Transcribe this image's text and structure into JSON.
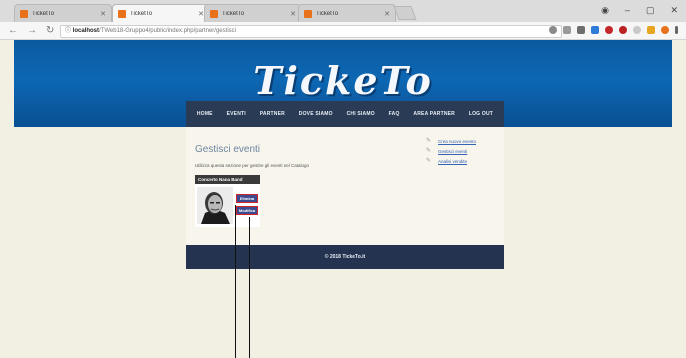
{
  "browser": {
    "tabs": [
      {
        "label": "TicketTo",
        "active": false
      },
      {
        "label": "TicketTo",
        "active": true
      },
      {
        "label": "TicketTo",
        "active": false
      },
      {
        "label": "TicketTo",
        "active": false
      }
    ],
    "url_host": "localhost",
    "url_path": "/TWeb18-Gruppo4/public/index.php/partner/gestisci",
    "window_min": "–",
    "window_max": "▢",
    "window_close": "✕"
  },
  "site": {
    "logo": "TickeTo",
    "nav": [
      "HOME",
      "EVENTI",
      "PARTNER",
      "DOVE SIAMO",
      "CHI SIAMO",
      "FAQ",
      "AREA PARTNER",
      "LOG OUT"
    ]
  },
  "page": {
    "title": "Gestisci eventi",
    "description": "Utilizza questa sezione per gestire gli eventi nel Catalogo",
    "side_links": [
      "Crea nuovo evento",
      "Gestisci eventi",
      "Analisi vendite"
    ]
  },
  "event_card": {
    "title": "Concerto Nana Band",
    "buttons": [
      "Elimina",
      "Modifica"
    ]
  },
  "footer": {
    "text": "© 2018 TickeTo.it"
  },
  "colors": {
    "header_blue": "#0d67b3",
    "nav_bg": "#2a3b55",
    "page_bg": "#f2efe3",
    "button_bg": "#3d4a8e",
    "button_border": "#d0242a",
    "link": "#3563b6"
  }
}
